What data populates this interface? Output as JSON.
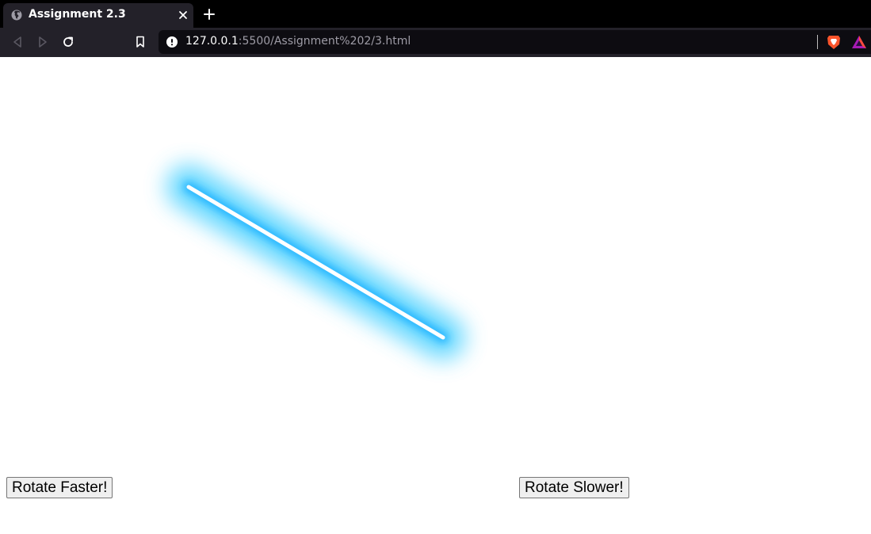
{
  "browser": {
    "tab": {
      "title": "Assignment 2.3"
    },
    "address": {
      "host": "127.0.0.1",
      "path": ":5500/Assignment%202/3.html"
    }
  },
  "page": {
    "buttons": {
      "faster_label": "Rotate Faster!",
      "slower_label": "Rotate Slower!"
    }
  },
  "colors": {
    "glow": "#4fd2ff",
    "core": "#ffffff",
    "tab_bg": "#232129",
    "toolbar_bg": "#232129"
  },
  "icons": [
    "globe-icon",
    "close-icon",
    "plus-icon",
    "back-icon",
    "forward-icon",
    "reload-icon",
    "bookmark-icon",
    "info-icon",
    "brave-shields-icon",
    "brave-rewards-icon"
  ]
}
